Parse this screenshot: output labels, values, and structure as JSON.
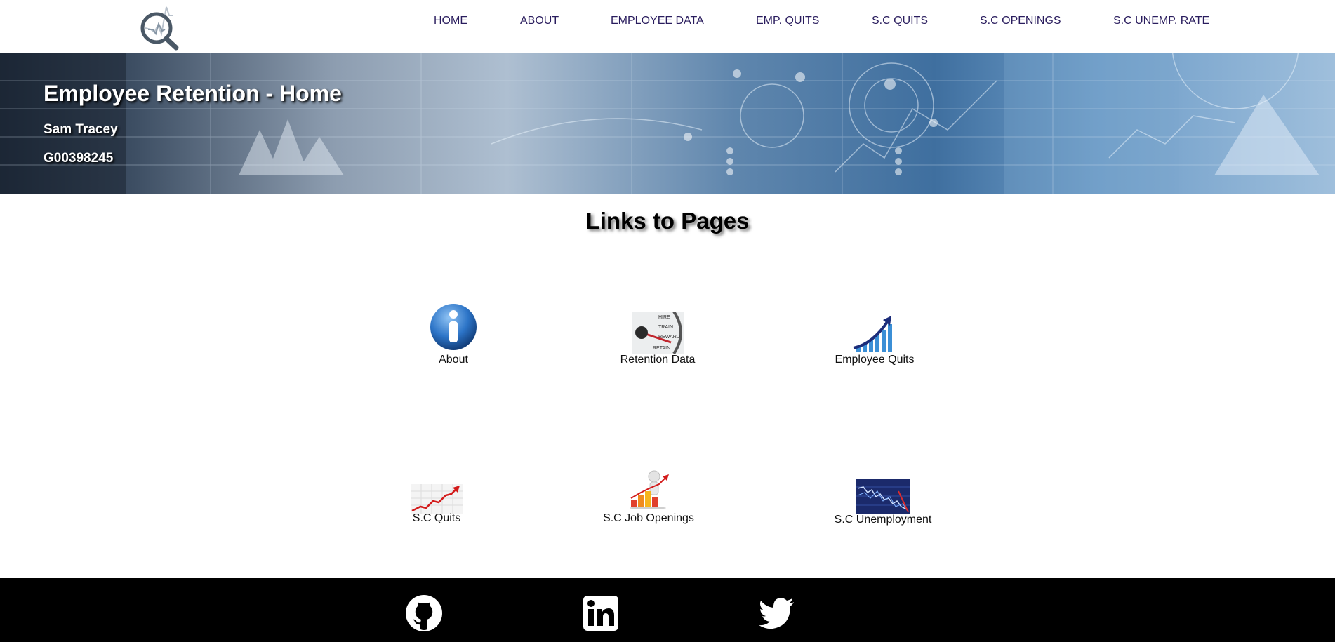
{
  "nav": {
    "items": [
      {
        "label": "HOME"
      },
      {
        "label": "ABOUT"
      },
      {
        "label": "EMPLOYEE DATA"
      },
      {
        "label": "EMP. QUITS"
      },
      {
        "label": "S.C QUITS"
      },
      {
        "label": "S.C OPENINGS"
      },
      {
        "label": "S.C UNEMP. RATE"
      }
    ],
    "color": "#2a1d5e"
  },
  "banner": {
    "title": "Employee Retention - Home",
    "name": "Sam Tracey",
    "id": "G00398245"
  },
  "links_section": {
    "title": "Links to Pages",
    "tiles": [
      {
        "label": "About",
        "icon": "info-icon"
      },
      {
        "label": "Retention Data",
        "icon": "retention-gauge-icon"
      },
      {
        "label": "Employee Quits",
        "icon": "growth-chart-icon"
      },
      {
        "label": "S.C Quits",
        "icon": "rising-line-icon"
      },
      {
        "label": "S.C Job Openings",
        "icon": "person-bar-chart-icon"
      },
      {
        "label": "S.C Unemployment",
        "icon": "stock-chart-icon"
      }
    ]
  },
  "footer": {
    "social": [
      {
        "icon": "github-icon"
      },
      {
        "icon": "linkedin-icon"
      },
      {
        "icon": "twitter-icon"
      }
    ]
  }
}
